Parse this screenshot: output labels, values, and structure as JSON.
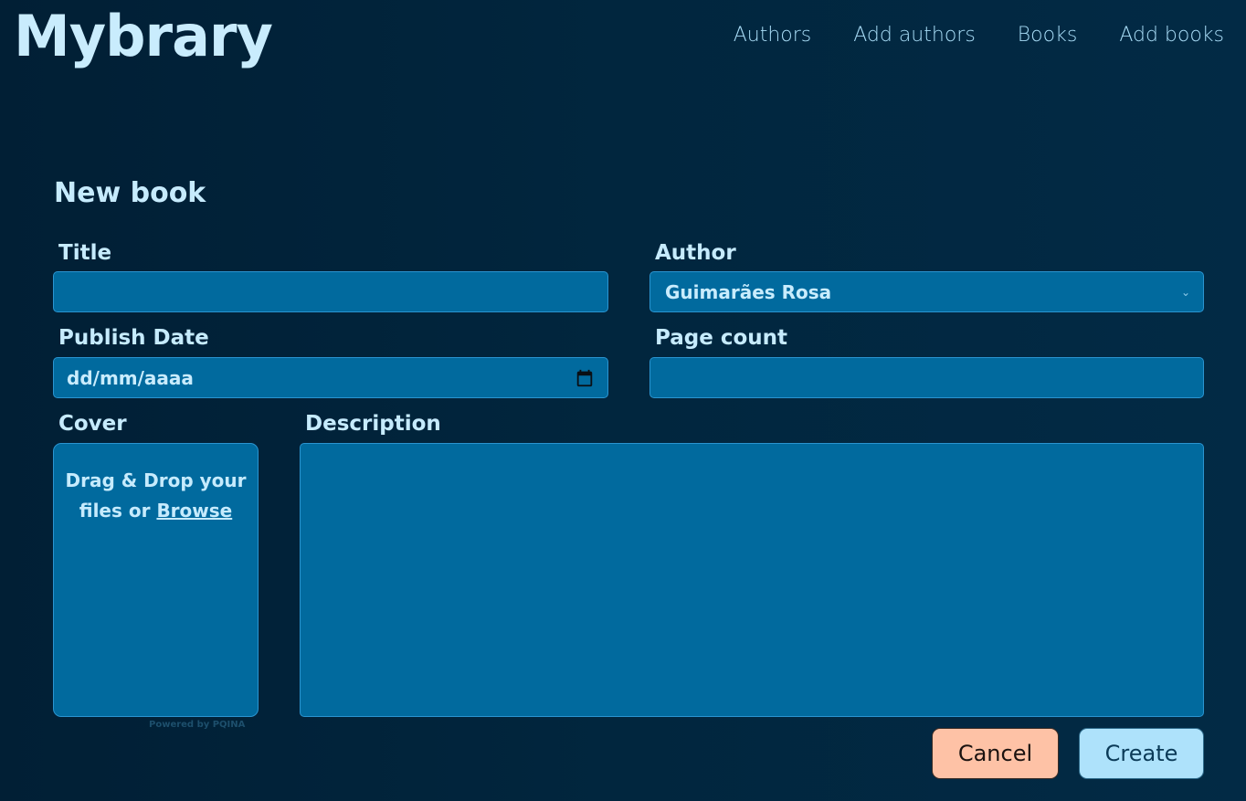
{
  "header": {
    "brand": "Mybrary",
    "nav": [
      "Authors",
      "Add authors",
      "Books",
      "Add books"
    ]
  },
  "form": {
    "title": "New book",
    "title_label": "Title",
    "title_value": "",
    "author_label": "Author",
    "author_selected": "Guimarães Rosa",
    "publish_date_label": "Publish Date",
    "publish_date_placeholder": "dd/mm/aaaa",
    "page_count_label": "Page count",
    "page_count_value": "",
    "cover_label": "Cover",
    "dropzone_text": "Drag & Drop your files or",
    "dropzone_browse": "Browse",
    "powered_by": "Powered by PQINA",
    "description_label": "Description",
    "description_value": ""
  },
  "actions": {
    "cancel": "Cancel",
    "create": "Create"
  },
  "colors": {
    "background": "#012540",
    "field": "#016a9e",
    "field_border": "#2a94d0",
    "text": "#c6ebfd",
    "cancel": "#fec2a6",
    "create": "#aee2fb"
  },
  "icons": {
    "date": "calendar-icon",
    "select": "chevron-down-icon"
  }
}
